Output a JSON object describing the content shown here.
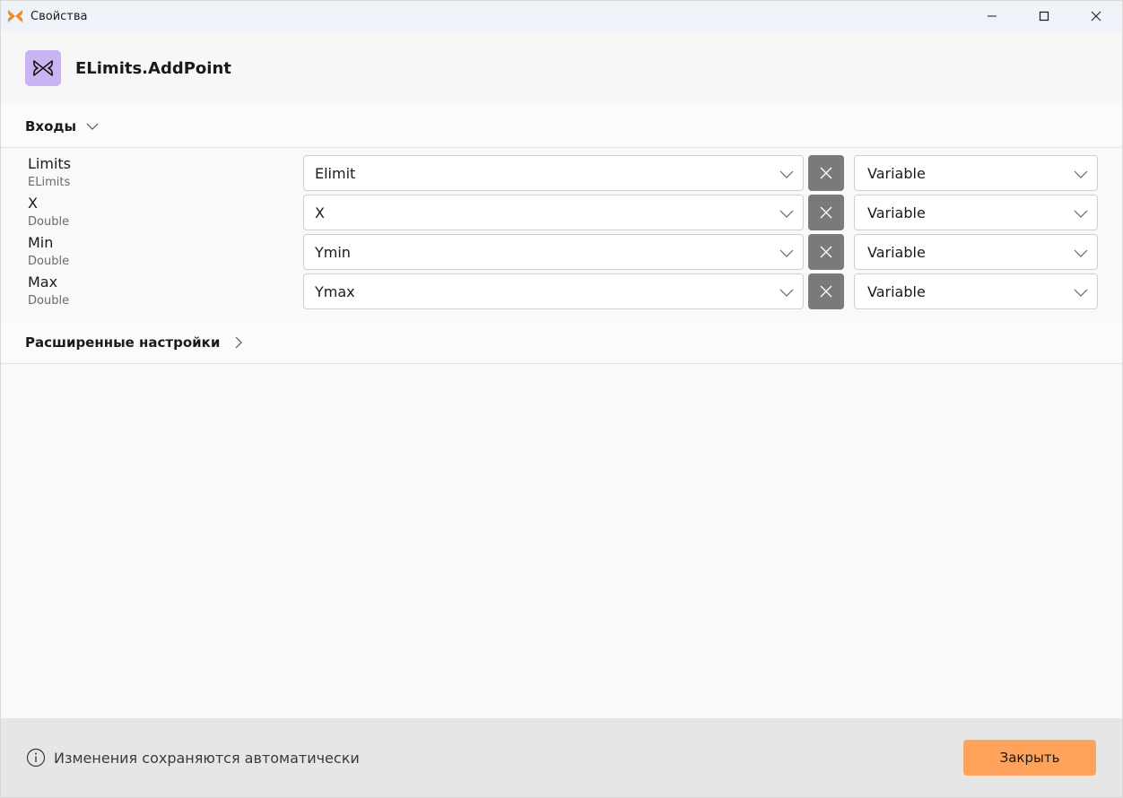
{
  "window": {
    "title": "Свойства",
    "icons": {
      "app": "butterfly-icon",
      "minimize": "minimize-icon",
      "maximize": "maximize-icon",
      "close": "close-icon"
    }
  },
  "header": {
    "title": "ELimits.AddPoint",
    "icon": "butterfly-icon",
    "icon_bg": "#c9b3f2"
  },
  "inputs_section": {
    "label": "Входы",
    "expanded": true,
    "rows": [
      {
        "name": "Limits",
        "type": "ELimits",
        "value": "Elimit",
        "mode": "Variable"
      },
      {
        "name": "X",
        "type": "Double",
        "value": "X",
        "mode": "Variable"
      },
      {
        "name": "Min",
        "type": "Double",
        "value": "Ymin",
        "mode": "Variable"
      },
      {
        "name": "Max",
        "type": "Double",
        "value": "Ymax",
        "mode": "Variable"
      }
    ]
  },
  "advanced_section": {
    "label": "Расширенные настройки",
    "expanded": false
  },
  "footer": {
    "info_text": "Изменения сохраняются автоматически",
    "close_label": "Закрыть",
    "close_color": "#ffa35c"
  }
}
